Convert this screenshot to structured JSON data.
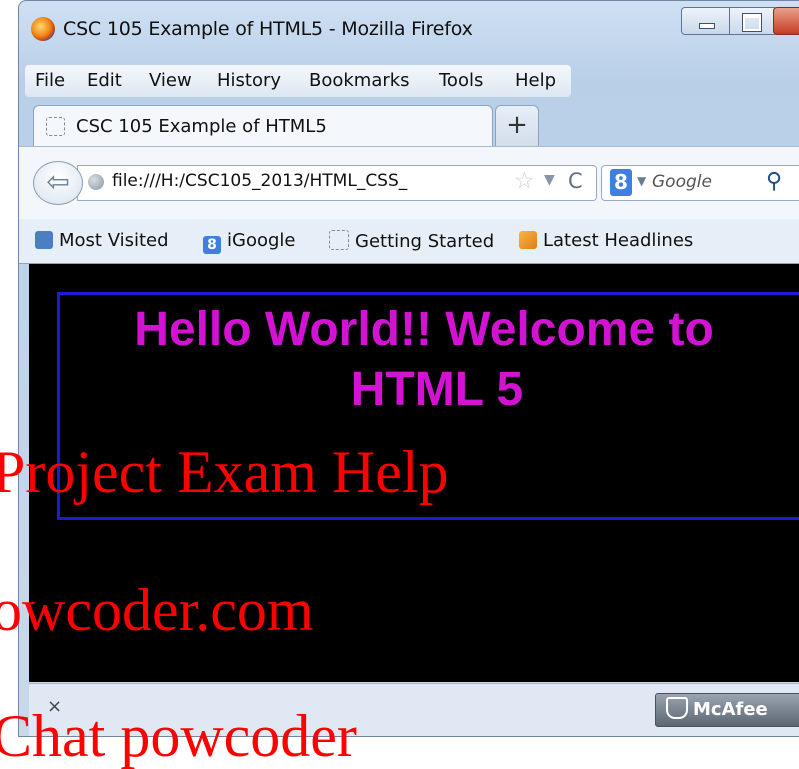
{
  "window": {
    "title": "CSC 105 Example of HTML5 - Mozilla Firefox"
  },
  "menu": [
    "File",
    "Edit",
    "View",
    "History",
    "Bookmarks",
    "Tools",
    "Help"
  ],
  "tab": {
    "title": "CSC 105 Example of HTML5",
    "new_tab": "+"
  },
  "nav": {
    "url": "file:///H:/CSC105_2013/HTML_CSS_",
    "search_engine": "8",
    "search_placeholder": "Google",
    "star": "☆",
    "reload": "C"
  },
  "bookmarks": [
    {
      "label": "Most Visited",
      "icon": "most-visited-icon"
    },
    {
      "label": "iGoogle",
      "icon": "igoogle-icon"
    },
    {
      "label": "Getting Started",
      "icon": "page-icon"
    },
    {
      "label": "Latest Headlines",
      "icon": "rss-icon"
    }
  ],
  "page": {
    "heading_line1": "Hello World!! Welcome to",
    "heading_line2": "HTML 5"
  },
  "status": {
    "close": "×",
    "mcafee": "McAfee"
  },
  "watermark": {
    "line1": "Project Exam Help",
    "line2": "owcoder.com",
    "line3": "Chat powcoder"
  },
  "colors": {
    "heading": "#d312d3",
    "border": "#1b1bd8",
    "watermark": "#ff0000",
    "background": "#000000"
  }
}
